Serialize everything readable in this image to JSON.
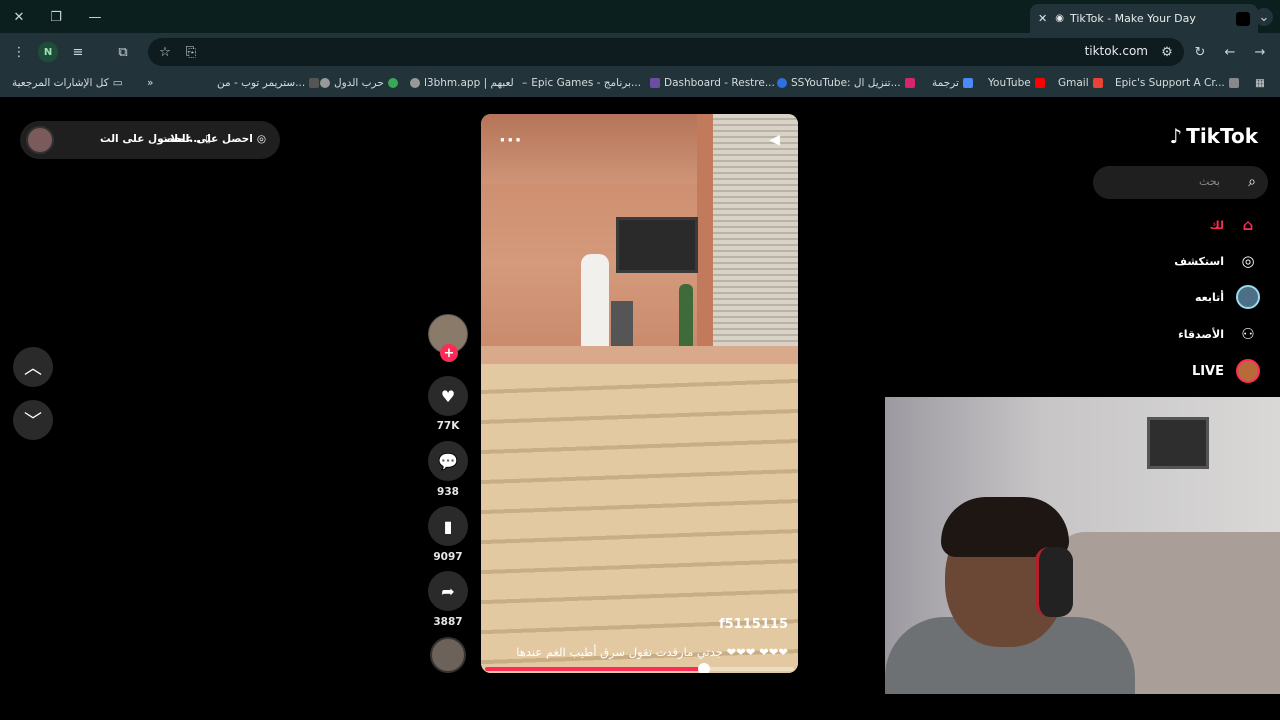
{
  "browser": {
    "tab_title": "TikTok - Make Your Day",
    "url": "tiktok.com",
    "profile_initial": "N",
    "bookmarks": [
      "كل الإشارات المرجعية",
      "ستريمر توب - من...",
      "حرب الدول",
      "l3bhm.app | لعبهم",
      "Epic Games - برنامج...",
      "Dashboard - Restre...",
      "SSYouTube: تنزيل ال...",
      "ترجمة",
      "YouTube",
      "Gmail",
      "Epic's Support A Cr..."
    ]
  },
  "promo": {
    "get_coins": "احصل على عملات",
    "get_app": "الحصول على الت..."
  },
  "video": {
    "username": "f5115115",
    "caption": "جدتي مارقدت تقول سرق أطيب الغم عندها ❤❤❤ ❤❤❤",
    "progress_fraction": 0.71
  },
  "actions": {
    "likes": "77K",
    "comments": "938",
    "saves": "9097",
    "shares": "3887"
  },
  "sidebar": {
    "logo": "TikTok",
    "search_placeholder": "بحث",
    "items": [
      {
        "label": "لك",
        "icon": "home-icon"
      },
      {
        "label": "استكشف",
        "icon": "compass-icon"
      },
      {
        "label": "أتابعه",
        "icon": "following-avatar-icon"
      },
      {
        "label": "الأصدقاء",
        "icon": "friends-icon"
      },
      {
        "label": "LIVE",
        "icon": "live-icon"
      }
    ]
  },
  "colors": {
    "accent": "#fe2c55",
    "background": "#000000"
  }
}
